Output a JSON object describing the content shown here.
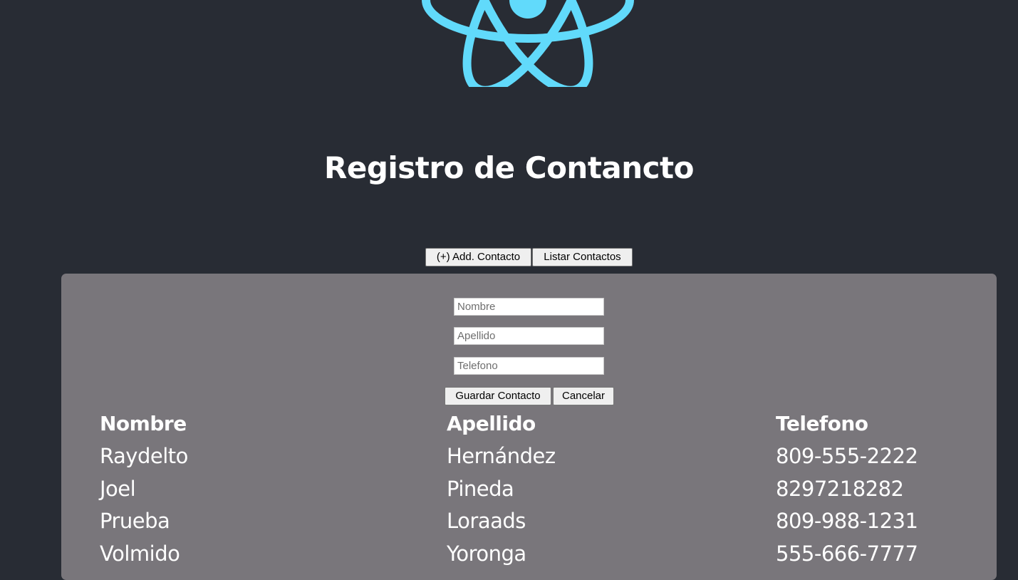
{
  "header": {
    "logo_icon": "react-atom-logo-icon",
    "logo_color": "#61dafb",
    "title": "Registro de Contancto"
  },
  "toolbar": {
    "add_label": "(+) Add. Contacto",
    "list_label": "Listar Contactos"
  },
  "form": {
    "nombre_placeholder": "Nombre",
    "nombre_value": "",
    "apellido_placeholder": "Apellido",
    "apellido_value": "",
    "telefono_placeholder": "Telefono",
    "telefono_value": "",
    "save_label": "Guardar Contacto",
    "cancel_label": "Cancelar"
  },
  "table": {
    "headers": [
      "Nombre",
      "Apellido",
      "Telefono"
    ],
    "rows": [
      [
        "Raydelto",
        "Hernández",
        "809-555-2222"
      ],
      [
        "Joel",
        "Pineda",
        "8297218282"
      ],
      [
        "Prueba",
        "Loraads",
        "809-988-1231"
      ],
      [
        "Volmido",
        "Yoronga",
        "555-666-7777"
      ]
    ]
  },
  "colors": {
    "background": "#282c34",
    "panel": "#79767b",
    "accent": "#61dafb"
  }
}
